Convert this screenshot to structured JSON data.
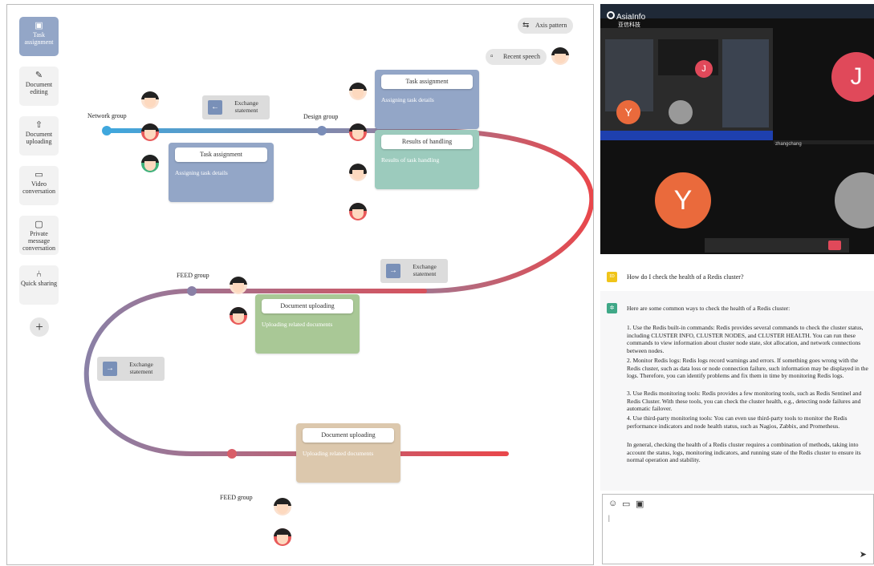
{
  "toolbar": {
    "items": [
      {
        "label": "Task assignment",
        "icon": "task-icon"
      },
      {
        "label": "Document editing",
        "icon": "edit-icon"
      },
      {
        "label": "Document uploading",
        "icon": "upload-icon"
      },
      {
        "label": "Video conversation",
        "icon": "video-icon"
      },
      {
        "label": "Private message conversation",
        "icon": "message-icon"
      },
      {
        "label": "Quick sharing",
        "icon": "share-icon"
      }
    ],
    "add": "+"
  },
  "top_controls": {
    "axis_pattern": "Axis pattern",
    "recent_speech": "Recent speech"
  },
  "groups": {
    "network": "Network group",
    "design": "Design group",
    "feed1": "FEED group",
    "feed2": "FEED group"
  },
  "cards": [
    {
      "title": "Task assignment",
      "body": "Assigning task details",
      "color": "#93a6c7"
    },
    {
      "title": "Task assignment",
      "body": "Assigning task details",
      "color": "#93a6c7"
    },
    {
      "title": "Results of handling",
      "body": "Results of task handling",
      "color": "#9ccbbd"
    },
    {
      "title": "Document uploading",
      "body": "Uploading related documents",
      "color": "#a9c896"
    },
    {
      "title": "Document uploading",
      "body": "Uploading related documents",
      "color": "#dcc8ad"
    }
  ],
  "exchanges": [
    {
      "label": "Exchange statement",
      "arrow": "←"
    },
    {
      "label": "Exchange statement",
      "arrow": "→"
    },
    {
      "label": "Exchange statement",
      "arrow": "→"
    }
  ],
  "video": {
    "brand": "AsiaInfo",
    "brand_sub": "亚信科技",
    "tiles": [
      {
        "letter": "J",
        "color": "#e0495a"
      },
      {
        "letter": "Y",
        "color": "#ea6a3c"
      }
    ],
    "mini_label": "zhangchang"
  },
  "chat": {
    "question": "How do I check the health of a Redis cluster?",
    "intro": "Here are some common ways to check the health of a Redis cluster:",
    "points": [
      "1. Use the Redis built-in commands: Redis provides several commands to check the cluster status, including CLUSTER INFO, CLUSTER NODES, and CLUSTER HEALTH. You can run these commands to view information about cluster node state, slot allocation, and network connections between nodes.",
      "2. Monitor Redis logs: Redis logs record warnings and errors. If something goes wrong with the Redis cluster, such as data loss or node connection failure, such information may be displayed in the logs. Therefore, you can identify problems and fix them in time by monitoring Redis logs.",
      "3. Use Redis monitoring tools: Redis provides a few monitoring tools, such as Redis Sentinel and Redis Cluster. With these tools, you can check the cluster health, e.g., detecting node failures and automatic failover.",
      "4. Use third-party monitoring tools: You can even use third-party tools to monitor the Redis performance indicators and node health status, such as Nagios, Zabbix, and Prometheus."
    ],
    "conclusion": "In general, checking the health of a Redis cluster requires a combination of methods, taking into account the status, logs, monitoring indicators, and running state of the Redis cluster to ensure its normal operation and stability."
  },
  "compose": {
    "value": "|"
  },
  "colors": {
    "accent": "#93a6c7",
    "line_blue": "#3fa7dd",
    "line_red": "#e9474b"
  }
}
